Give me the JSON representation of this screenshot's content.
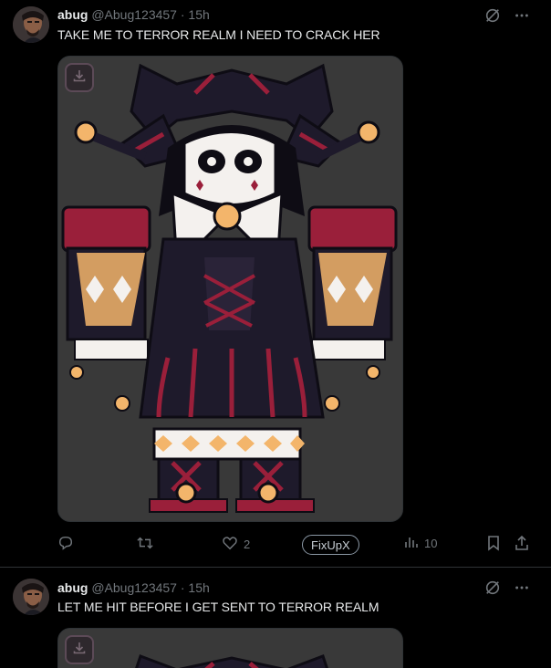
{
  "posts": [
    {
      "name": "abug",
      "handle": "@Abug123457",
      "dot": "·",
      "time": "15h",
      "text": "TAKE ME TO TERROR REALM I NEED TO CRACK HER",
      "actions": {
        "like_count": "2",
        "fixup_label": "FixUpX",
        "view_count": "10"
      }
    },
    {
      "name": "abug",
      "handle": "@Abug123457",
      "dot": "·",
      "time": "15h",
      "text": "LET ME HIT BEFORE I GET SENT TO TERROR REALM"
    }
  ],
  "icons": [
    "grok-icon",
    "more-icon",
    "download-icon",
    "reply-icon",
    "retweet-icon",
    "like-icon",
    "views-icon",
    "bookmark-icon",
    "share-icon"
  ],
  "colors": {
    "background": "#000000",
    "muted": "#71767b",
    "text": "#e7e9ea",
    "media_bg": "#3a3a3a",
    "jester_red": "#9a1f3a",
    "jester_navy": "#1e1a2b"
  }
}
